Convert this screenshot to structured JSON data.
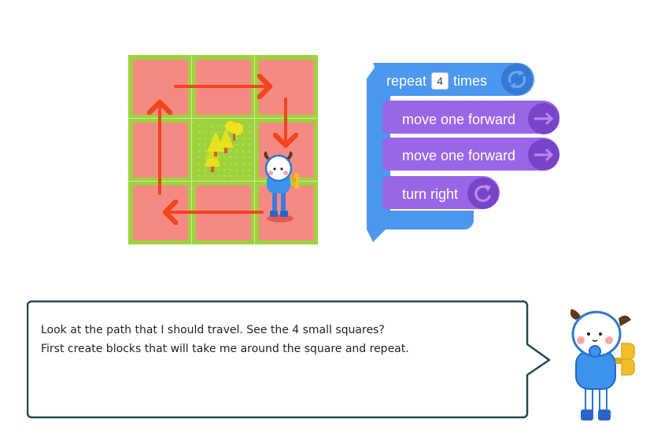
{
  "blocks": {
    "repeat_label": "repeat",
    "repeat_count": "4",
    "times_label": "times",
    "commands": [
      {
        "label": "move one forward",
        "icon": "arrow-right-icon"
      },
      {
        "label": "move one forward",
        "icon": "arrow-right-icon"
      },
      {
        "label": "turn right",
        "icon": "turn-right-icon"
      }
    ],
    "colors": {
      "repeat": "#4C97F0",
      "command": "#9966E8",
      "icon_bg": "#7A44C9"
    }
  },
  "board": {
    "rows": 3,
    "cols": 3,
    "tile_colors": {
      "path": "#F58A84",
      "grass": "#9ED23C",
      "border": "#7DC542"
    },
    "arrow_color": "#F1451D"
  },
  "dialog": {
    "line1": "Look at the path that I should travel. See the 4 small squares?",
    "line2": "First create blocks that will take me around the square and repeat."
  }
}
